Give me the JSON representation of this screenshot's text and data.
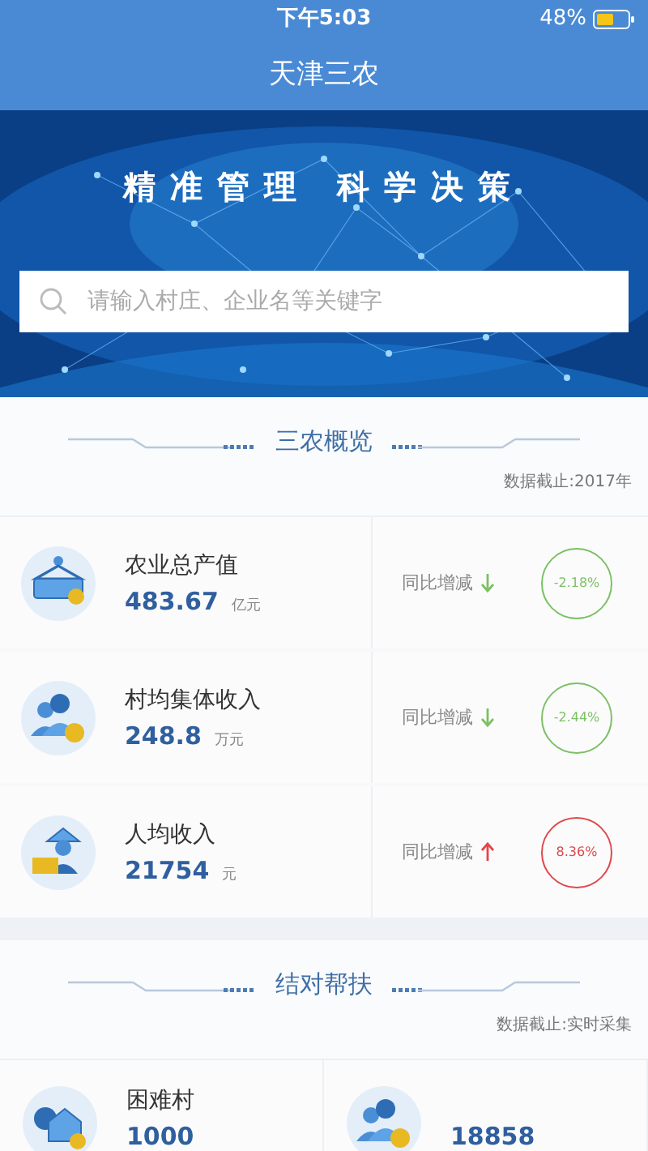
{
  "status_bar": {
    "time": "下午5:03",
    "battery": "48%"
  },
  "header": {
    "title": "天津三农"
  },
  "banner": {
    "slogan": "精准管理 科学决策",
    "search": {
      "placeholder": "请输入村庄、企业名等关键字"
    }
  },
  "sections": [
    {
      "kind": "stats",
      "title": "三农概览",
      "note": "数据截止:2017年",
      "items": [
        {
          "label": "农业总产值",
          "value": "483.67",
          "unit": "亿元",
          "change_label": "同比增减",
          "increase": false,
          "change": "-2.18%"
        },
        {
          "label": "村均集体收入",
          "value": "248.8",
          "unit": "万元",
          "change_label": "同比增减",
          "increase": false,
          "change": "-2.44%"
        },
        {
          "label": "人均收入",
          "value": "21754",
          "unit": "元",
          "change_label": "同比增减",
          "increase": true,
          "change": "8.36%"
        }
      ]
    },
    {
      "kind": "tiles",
      "title": "结对帮扶",
      "note": "数据截止:实时采集",
      "items": [
        {
          "label": "困难村",
          "value": "1000"
        },
        {
          "value": "18858"
        }
      ]
    }
  ]
}
